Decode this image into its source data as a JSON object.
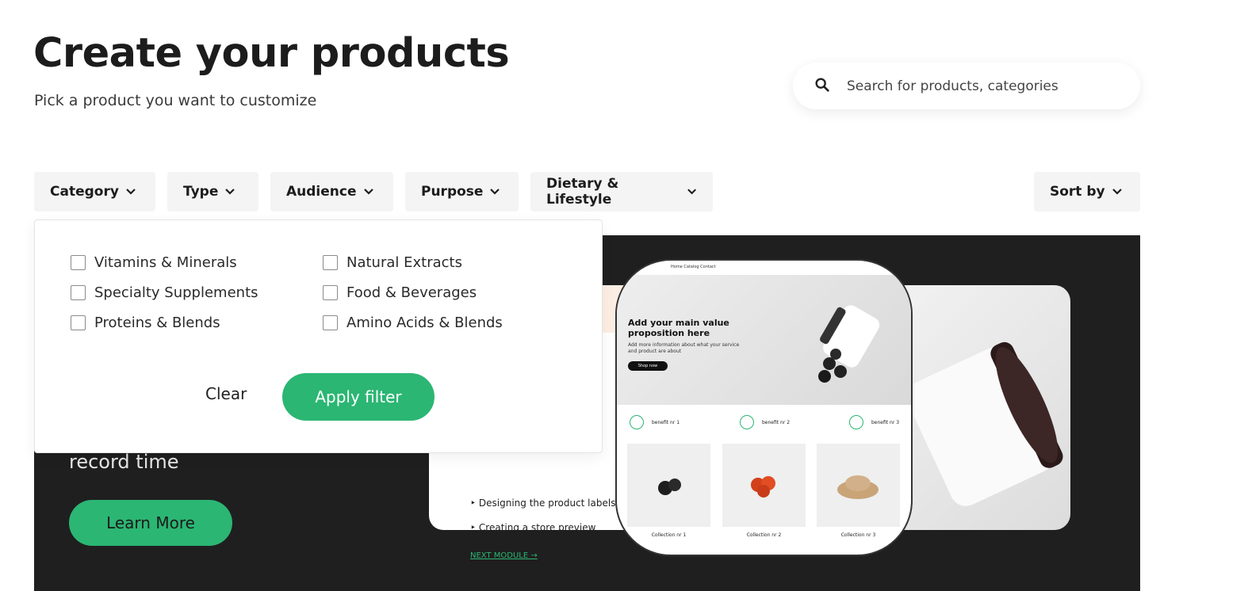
{
  "header": {
    "title": "Create your products",
    "subtitle": "Pick a product you want to customize"
  },
  "search": {
    "placeholder": "Search for products, categories",
    "icon": "search-icon"
  },
  "filters": [
    {
      "label": "Category"
    },
    {
      "label": "Type"
    },
    {
      "label": "Audience"
    },
    {
      "label": "Purpose"
    },
    {
      "label": "Dietary & Lifestyle"
    }
  ],
  "sort": {
    "label": "Sort by"
  },
  "dropdown": {
    "options": [
      {
        "label": "Vitamins & Minerals",
        "checked": false
      },
      {
        "label": "Natural Extracts",
        "checked": false
      },
      {
        "label": "Specialty Supplements",
        "checked": false
      },
      {
        "label": "Food & Beverages",
        "checked": false
      },
      {
        "label": "Proteins & Blends",
        "checked": false
      },
      {
        "label": "Amino Acids & Blends",
        "checked": false
      }
    ],
    "clear_label": "Clear",
    "apply_label": "Apply filter"
  },
  "banner": {
    "text": "record time",
    "button_label": "Learn More",
    "course_items": [
      "Designing the product labels",
      "Creating a store preview"
    ],
    "next_module": "NEXT MODULE →",
    "phone": {
      "nav": "Home   Catalog   Contact",
      "headline": "Add your main value proposition here",
      "small": "Add more information about what your service and product are about",
      "shop": "Shop now",
      "benefits": [
        "benefit nr 1",
        "benefit nr 2",
        "benefit nr 3"
      ],
      "collections": [
        "Collection nr 1",
        "Collection nr 2",
        "Collection nr 3"
      ]
    }
  },
  "colors": {
    "accent": "#2bb673",
    "banner_bg": "#1f1f1f",
    "filter_bg": "#f4f4f4"
  }
}
